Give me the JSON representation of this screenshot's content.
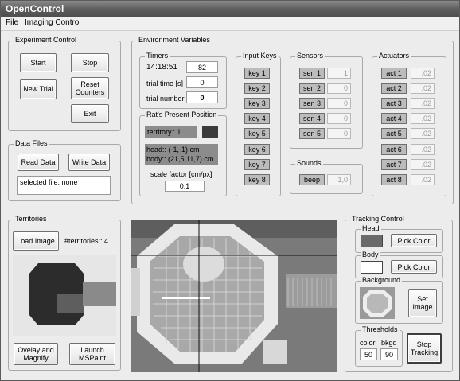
{
  "window": {
    "title": "OpenControl"
  },
  "menu": {
    "file": "File",
    "imaging": "Imaging Control"
  },
  "experiment": {
    "title": "Experiment Control",
    "start": "Start",
    "stop": "Stop",
    "new_trial": "New Trial",
    "reset_counters": "Reset Counters",
    "exit": "Exit"
  },
  "data_files": {
    "title": "Data Files",
    "read": "Read Data",
    "write": "Write Data",
    "selected_file": "selected file: none"
  },
  "environment": {
    "title": "Environment Variables",
    "timers": {
      "title": "Timers",
      "clock": "14:18:51",
      "clock_count": "82",
      "trial_time_label": "trial time [s]",
      "trial_time": "0",
      "trial_number_label": "trial number",
      "trial_number": "0"
    },
    "position": {
      "title": "Rat's Present Position",
      "territory": "territory.: 1",
      "head": "head:: (-1,-1) cm",
      "body": "body:: (21,5,11,7) cm",
      "scale_label": "scale factor [cm/px]",
      "scale_value": "0.1"
    },
    "input_keys": {
      "title": "Input Keys",
      "keys": [
        "key 1",
        "key 2",
        "key 3",
        "key 4",
        "key 5",
        "key 6",
        "key 7",
        "key 8"
      ]
    },
    "sensors": {
      "title": "Sensors",
      "items": [
        {
          "label": "sen 1",
          "value": "1"
        },
        {
          "label": "sen 2",
          "value": "0"
        },
        {
          "label": "sen 3",
          "value": "0"
        },
        {
          "label": "sen 4",
          "value": "0"
        },
        {
          "label": "sen 5",
          "value": "0"
        }
      ]
    },
    "sounds": {
      "title": "Sounds",
      "label": "beep",
      "value": "1,0"
    },
    "actuators": {
      "title": "Actuators",
      "items": [
        {
          "label": "act 1",
          "value": ".02"
        },
        {
          "label": "act 2",
          "value": ".02"
        },
        {
          "label": "act 3",
          "value": ".02"
        },
        {
          "label": "act 4",
          "value": ".02"
        },
        {
          "label": "act 5",
          "value": ".02"
        },
        {
          "label": "act 6",
          "value": ".02"
        },
        {
          "label": "act 7",
          "value": ".02"
        },
        {
          "label": "act 8",
          "value": ".02"
        }
      ]
    }
  },
  "territories": {
    "title": "Territories",
    "load_image": "Load Image",
    "count_label": "#territories:: 4",
    "overlay": "Ovelay and Magnify",
    "launch": "Launch MSPaint"
  },
  "tracking": {
    "title": "Tracking Control",
    "head_title": "Head",
    "body_title": "Body",
    "background_title": "Background",
    "pick_color": "Pick Color",
    "set_image": "Set Image",
    "thresholds_title": "Thresholds",
    "color_label": "color",
    "bkgd_label": "bkgd",
    "color_value": "50",
    "bkgd_value": "90",
    "stop_tracking": "Stop Tracking"
  }
}
